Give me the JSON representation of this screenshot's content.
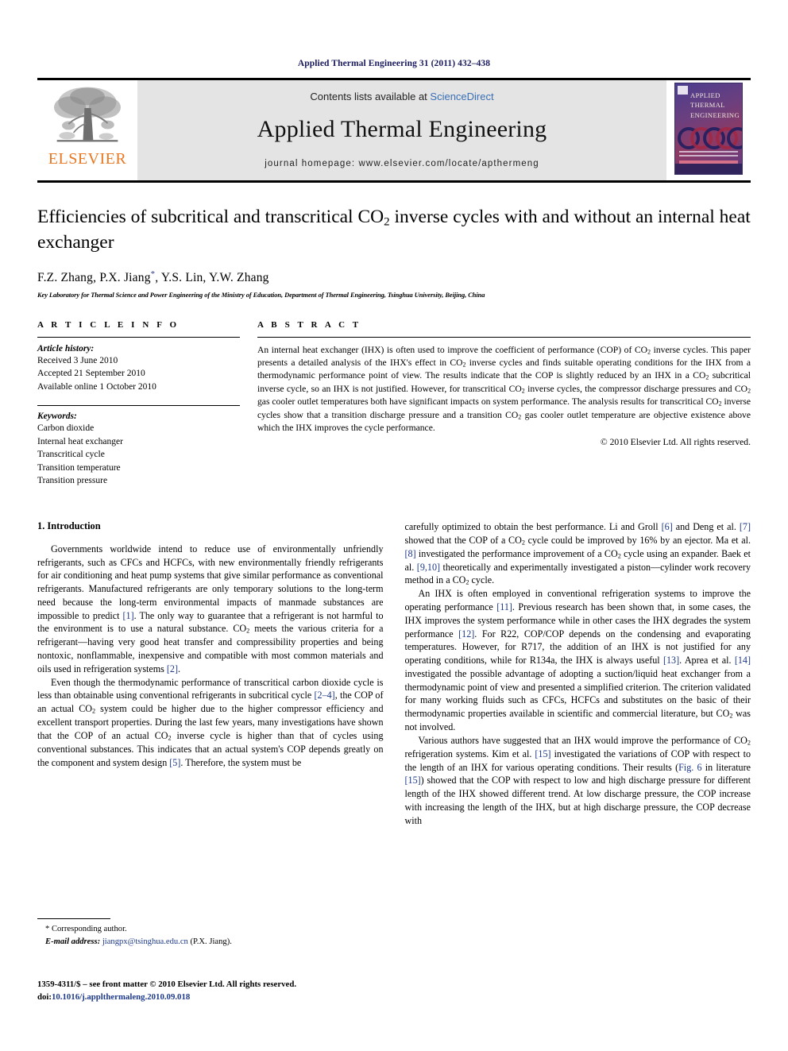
{
  "running_head": "Applied Thermal Engineering 31 (2011) 432–438",
  "masthead": {
    "publisher_name": "ELSEVIER",
    "contents_prefix": "Contents lists available at ",
    "contents_link": "ScienceDirect",
    "journal_title": "Applied Thermal Engineering",
    "homepage_line": "journal homepage: www.elsevier.com/locate/apthermeng",
    "cover_title_lines": [
      "APPLIED",
      "THERMAL",
      "ENGINEERING"
    ]
  },
  "article": {
    "title_part1": "Efficiencies of subcritical and transcritical CO",
    "title_sub": "2",
    "title_part2": " inverse cycles with and without an internal heat exchanger",
    "authors": "F.Z. Zhang, P.X. Jiang",
    "authors_star": "*",
    "authors_rest": ", Y.S. Lin, Y.W. Zhang",
    "affiliation": "Key Laboratory for Thermal Science and Power Engineering of the Ministry of Education, Department of Thermal Engineering, Tsinghua University, Beijing, China"
  },
  "article_info": {
    "heading": "A R T I C L E   I N F O",
    "history_title": "Article history:",
    "history": [
      "Received 3 June 2010",
      "Accepted 21 September 2010",
      "Available online 1 October 2010"
    ],
    "keywords_title": "Keywords:",
    "keywords": [
      "Carbon dioxide",
      "Internal heat exchanger",
      "Transcritical cycle",
      "Transition temperature",
      "Transition pressure"
    ]
  },
  "abstract": {
    "heading": "A B S T R A C T",
    "p1_a": "An internal heat exchanger (IHX) is often used to improve the coefficient of performance (COP) of CO",
    "p1_b": " inverse cycles. This paper presents a detailed analysis of the IHX's effect in CO",
    "p1_c": " inverse cycles and finds suitable operating conditions for the IHX from a thermodynamic performance point of view. The results indicate that the COP is slightly reduced by an IHX in a CO",
    "p1_d": " subcritical inverse cycle, so an IHX is not justified. However, for transcritical CO",
    "p1_e": " inverse cycles, the compressor discharge pressures and CO",
    "p1_f": " gas cooler outlet temperatures both have significant impacts on system performance. The analysis results for transcritical CO",
    "p1_g": " inverse cycles show that a transition discharge pressure and a transition CO",
    "p1_h": " gas cooler outlet temperature are objective existence above which the IHX improves the cycle performance.",
    "sub": "2",
    "copyright": "© 2010 Elsevier Ltd. All rights reserved."
  },
  "body": {
    "section_heading": "1. Introduction",
    "left_p1_a": "Governments worldwide intend to reduce use of environmentally unfriendly refrigerants, such as CFCs and HCFCs, with new environmentally friendly refrigerants for air conditioning and heat pump systems that give similar performance as conventional refrigerants. Manufactured refrigerants are only temporary solutions to the long-term need because the long-term environmental impacts of manmade substances are impossible to predict ",
    "left_p1_ref1": "[1]",
    "left_p1_b": ". The only way to guarantee that a refrigerant is not harmful to the environment is to use a natural substance. CO",
    "left_p1_c": " meets the various criteria for a refrigerant—having very good heat transfer and compressibility properties and being nontoxic, nonflammable, inexpensive and compatible with most common materials and oils used in refrigeration systems ",
    "left_p1_ref2": "[2]",
    "left_p1_d": ".",
    "left_p2_a": "Even though the thermodynamic performance of transcritical carbon dioxide cycle is less than obtainable using conventional refrigerants in subcritical cycle ",
    "left_p2_ref1": "[2–4]",
    "left_p2_b": ", the COP of an actual CO",
    "left_p2_c": " system could be higher due to the higher compressor efficiency and excellent transport properties. During the last few years, many investigations have shown that the COP of an actual CO",
    "left_p2_d": " inverse cycle is higher than that of cycles using conventional substances. This indicates that an actual system's COP depends greatly on the component and system design ",
    "left_p2_ref2": "[5]",
    "left_p2_e": ". Therefore, the system must be",
    "right_p1_a": "carefully optimized to obtain the best performance. Li and Groll ",
    "right_p1_ref1": "[6]",
    "right_p1_b": " and Deng et al. ",
    "right_p1_ref2": "[7]",
    "right_p1_c": " showed that the COP of a CO",
    "right_p1_d": " cycle could be improved by 16% by an ejector. Ma et al. ",
    "right_p1_ref3": "[8]",
    "right_p1_e": " investigated the performance improvement of a CO",
    "right_p1_f": " cycle using an expander. Baek et al. ",
    "right_p1_ref4": "[9,10]",
    "right_p1_g": " theoretically and experimentally investigated a piston—cylinder work recovery method in a CO",
    "right_p1_h": " cycle.",
    "right_p2_a": "An IHX is often employed in conventional refrigeration systems to improve the operating performance ",
    "right_p2_ref1": "[11]",
    "right_p2_b": ". Previous research has been shown that, in some cases, the IHX improves the system performance while in other cases the IHX degrades the system performance ",
    "right_p2_ref2": "[12]",
    "right_p2_c": ". For R22, COP/COP depends on the condensing and evaporating temperatures. However, for R717, the addition of an IHX is not justified for any operating conditions, while for R134a, the IHX is always useful ",
    "right_p2_ref3": "[13]",
    "right_p2_d": ". Aprea et al. ",
    "right_p2_ref4": "[14]",
    "right_p2_e": " investigated the possible advantage of adopting a suction/liquid heat exchanger from a thermodynamic point of view and presented a simplified criterion. The criterion validated for many working fluids such as CFCs, HCFCs and substitutes on the basic of their thermodynamic properties available in scientific and commercial literature, but CO",
    "right_p2_f": " was not involved.",
    "right_p3_a": "Various authors have suggested that an IHX would improve the performance of CO",
    "right_p3_b": " refrigeration systems. Kim et al. ",
    "right_p3_ref1": "[15]",
    "right_p3_c": " investigated the variations of COP with respect to the length of an IHX for various operating conditions. Their results (",
    "right_p3_fig": "Fig. 6",
    "right_p3_d": " in literature ",
    "right_p3_ref2": "[15]",
    "right_p3_e": ") showed that the COP with respect to low and high discharge pressure for different length of the IHX showed different trend. At low discharge pressure, the COP increase with increasing the length of the IHX, but at high discharge pressure, the COP decrease with"
  },
  "footnote": {
    "corresponding": "* Corresponding author.",
    "email_label": "E-mail address:",
    "email": "jiangpx@tsinghua.edu.cn",
    "email_suffix": " (P.X. Jiang)."
  },
  "footer": {
    "issn_line": "1359-4311/$ – see front matter © 2010 Elsevier Ltd. All rights reserved.",
    "doi_prefix": "doi:",
    "doi": "10.1016/j.applthermaleng.2010.09.018"
  },
  "colors": {
    "running_head": "#1a1a5e",
    "elsevier_orange": "#E87722",
    "link_blue": "#3a6fb5",
    "ref_blue": "#1e3a8a",
    "banner_gray": "#e4e4e4"
  }
}
